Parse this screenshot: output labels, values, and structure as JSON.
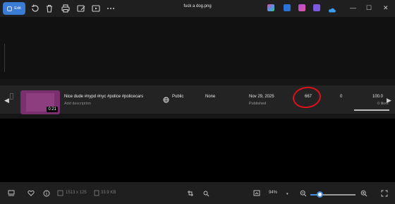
{
  "titlebar": {
    "edit_label": "Edit",
    "file_name": "fuck a dog.png",
    "icons": [
      "rotate-icon",
      "delete-icon",
      "print-icon",
      "edit-image-icon",
      "slideshow-icon",
      "more-icon"
    ],
    "window_controls": {
      "minimize": "—",
      "maximize": "☐",
      "close": "✕"
    }
  },
  "video_row": {
    "duration": "0:21",
    "title": "Nice dude #nypd #nyc #police #policecars",
    "description_placeholder": "Add description",
    "visibility": "Public",
    "restrictions": "None",
    "date": "Nov 29, 2025",
    "date_status": "Published",
    "views": "667",
    "comments": "0",
    "likes_percent": "100.0",
    "likes_count": "0 likes"
  },
  "statusbar": {
    "dimensions": "1513 x 125",
    "file_size": "33.9 KB",
    "zoom": "94%",
    "zoom_level": 0.2
  },
  "colors": {
    "accent": "#3a7bd5",
    "annotation": "#e0101a"
  }
}
